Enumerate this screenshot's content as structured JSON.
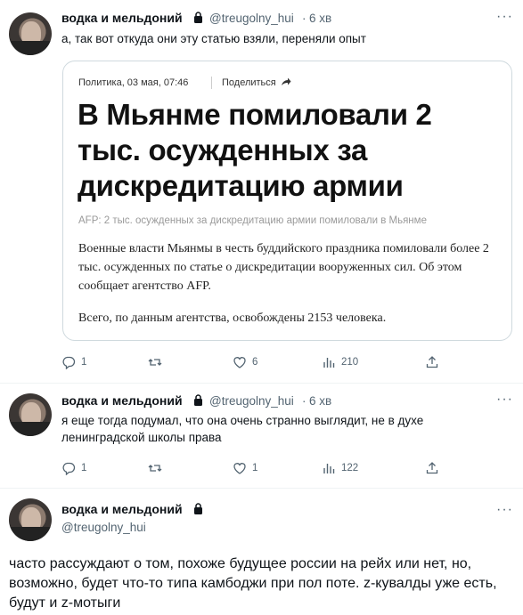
{
  "tweets": [
    {
      "author_name": "водка и мельдоний",
      "handle": "@treugolny_hui",
      "separator": "·",
      "time": "6 хв",
      "text": "а, так вот откуда они эту статью взяли, переняли опыт",
      "card": {
        "meta": "Политика, 03 мая, 07:46",
        "share_label": "Поделиться",
        "headline": "В Мьянме помиловали 2 тыс. осужденных за дискредитацию армии",
        "caption": "AFP: 2 тыс. осужденных за дискредитацию армии помиловали в Мьянме",
        "body_paragraph_1": "Военные власти Мьянмы в честь буддийского праздника помиловали более 2 тыс. осужденных по статье о дискредитации вооруженных сил. Об этом сообщает агентство AFP.",
        "body_paragraph_2": "Всего, по данным агентства, освобождены 2153 человека."
      },
      "actions": {
        "replies": "1",
        "retweets": "",
        "likes": "6",
        "views": "210"
      }
    },
    {
      "author_name": "водка и мельдоний",
      "handle": "@treugolny_hui",
      "separator": "·",
      "time": "6 хв",
      "text": "я еще тогда подумал, что она очень странно выглядит, не в духе ленинградской школы права",
      "actions": {
        "replies": "1",
        "retweets": "",
        "likes": "1",
        "views": "122"
      }
    },
    {
      "author_name": "водка и мельдоний",
      "handle": "@treugolny_hui",
      "text": "часто рассуждают о том, похоже будущее россии на рейх или нет, но, возможно, будет что-то типа камбоджи при пол поте.  z-кувалды уже есть, будут и z-мотыги"
    }
  ],
  "more_label": "···",
  "colors": {
    "text": "#0f1419",
    "secondary": "#536471",
    "border": "#cfd9de"
  },
  "icons": [
    "reply-icon",
    "retweet-icon",
    "like-icon",
    "views-icon",
    "share-icon",
    "lock-icon",
    "more-icon"
  ]
}
